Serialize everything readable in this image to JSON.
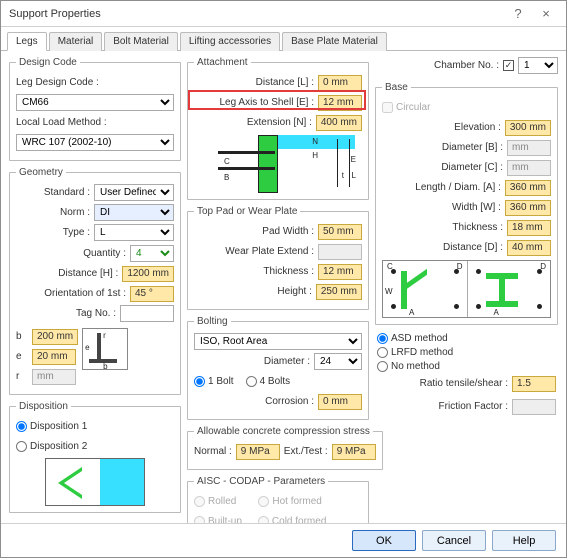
{
  "window": {
    "title": "Support Properties"
  },
  "tabs": [
    "Legs",
    "Material",
    "Bolt Material",
    "Lifting accessories",
    "Base Plate Material"
  ],
  "designCode": {
    "legend": "Design Code",
    "legDesignCodeLabel": "Leg Design Code :",
    "legDesignCodeValue": "CM66",
    "localLoadLabel": "Local Load Method :",
    "localLoadValue": "WRC 107 (2002-10)"
  },
  "geometry": {
    "legend": "Geometry",
    "standardLabel": "Standard :",
    "standardValue": "User Defined",
    "normLabel": "Norm :",
    "normValue": "DI",
    "typeLabel": "Type :",
    "typeValue": "L",
    "qtyLabel": "Quantity :",
    "qtyValue": "4",
    "distanceHLabel": "Distance [H] :",
    "distanceHValue": "1200 mm",
    "orient1Label": "Orientation of 1st :",
    "orient1Value": "45 °",
    "tagNoLabel": "Tag No. :",
    "tagNoValue": "",
    "bLabel": "b",
    "bValue": "200 mm",
    "eLabel": "e",
    "eValue": "20 mm",
    "rLabel": "r",
    "rValue": "mm",
    "ber_b": "b",
    "ber_e": "e",
    "ber_r": "r"
  },
  "disposition": {
    "legend": "Disposition",
    "opt1": "Disposition 1",
    "opt2": "Disposition 2"
  },
  "attachment": {
    "legend": "Attachment",
    "distanceLLabel": "Distance [L] :",
    "distanceLValue": "0 mm",
    "axisELabel": "Leg Axis to Shell [E] :",
    "axisEValue": "12 mm",
    "extNLabel": "Extension [N] :",
    "extNValue": "400 mm",
    "diagLabels": {
      "N": "N",
      "H": "H",
      "C": "C",
      "B": "B",
      "E": "E",
      "L": "L",
      "t": "t"
    }
  },
  "topPad": {
    "legend": "Top Pad or Wear Plate",
    "padWidthLabel": "Pad Width :",
    "padWidthValue": "50 mm",
    "wpExtendLabel": "Wear Plate Extend :",
    "wpExtendValue": "",
    "thickLabel": "Thickness :",
    "thickValue": "12 mm",
    "heightLabel": "Height :",
    "heightValue": "250 mm"
  },
  "bolting": {
    "legend": "Bolting",
    "selectValue": "ISO, Root Area",
    "diaLabel": "Diameter :",
    "diaValue": "24",
    "bolt1": "1 Bolt",
    "bolt4": "4 Bolts",
    "corrLabel": "Corrosion :",
    "corrValue": "0 mm",
    "asd": "ASD method",
    "lrfd": "LRFD method",
    "none": "No method",
    "ratioLabel": "Ratio tensile/shear :",
    "ratioValue": "1.5",
    "fricLabel": "Friction Factor :",
    "fricValue": ""
  },
  "allowConcrete": {
    "legend": "Allowable concrete compression stress",
    "normalLabel": "Normal :",
    "normalValue": "9 MPa",
    "extLabel": "Ext./Test :",
    "extValue": "9 MPa"
  },
  "aisc": {
    "legend": "AISC - CODAP - Parameters",
    "rolled": "Rolled",
    "builtup": "Built-up",
    "hot": "Hot formed",
    "cold": "Cold formed"
  },
  "chamber": {
    "label": "Chamber No. :",
    "check": "✓",
    "value": "1"
  },
  "base": {
    "legend": "Base",
    "circular": "Circular",
    "elevLabel": "Elevation :",
    "elevValue": "300 mm",
    "diaBLabel": "Diameter [B] :",
    "diaBValue": "mm",
    "diaCLabel": "Diameter [C] :",
    "diaCValue": "mm",
    "lenALabel": "Length / Diam. [A] :",
    "lenAValue": "360 mm",
    "widWLabel": "Width [W] :",
    "widWValue": "360 mm",
    "thkLabel": "Thickness :",
    "thkValue": "18 mm",
    "distDLabel": "Distance [D] :",
    "distDValue": "40 mm",
    "diagLabels": {
      "C": "C",
      "W": "W",
      "D": "D",
      "A": "A"
    }
  },
  "buttons": {
    "ok": "OK",
    "cancel": "Cancel",
    "help": "Help"
  }
}
